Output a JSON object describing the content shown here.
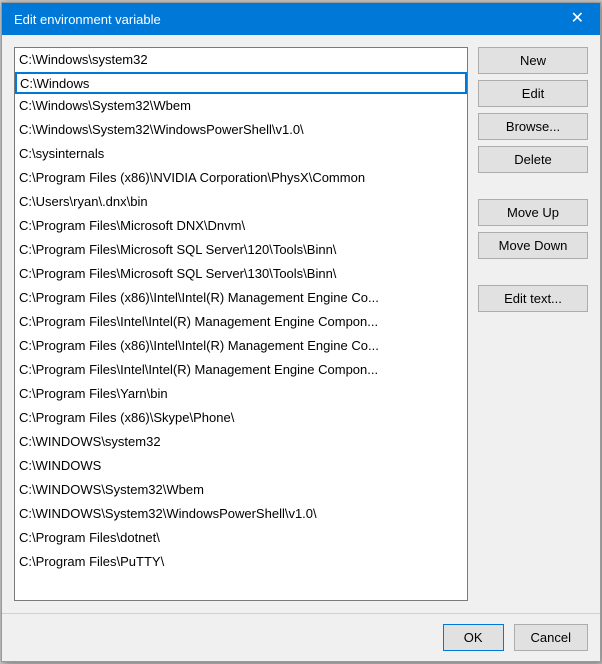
{
  "dialog": {
    "title": "Edit environment variable",
    "close_label": "✕"
  },
  "buttons": {
    "new_label": "New",
    "edit_label": "Edit",
    "browse_label": "Browse...",
    "delete_label": "Delete",
    "move_up_label": "Move Up",
    "move_down_label": "Move Down",
    "edit_text_label": "Edit text..."
  },
  "footer": {
    "ok_label": "OK",
    "cancel_label": "Cancel"
  },
  "list": {
    "top_item": "C:\\Windows\\system32",
    "editing_value": "C:\\Windows",
    "items": [
      "C:\\Windows\\System32\\Wbem",
      "C:\\Windows\\System32\\WindowsPowerShell\\v1.0\\",
      "C:\\sysinternals",
      "C:\\Program Files (x86)\\NVIDIA Corporation\\PhysX\\Common",
      "C:\\Users\\ryan\\.dnx\\bin",
      "C:\\Program Files\\Microsoft DNX\\Dnvm\\",
      "C:\\Program Files\\Microsoft SQL Server\\120\\Tools\\Binn\\",
      "C:\\Program Files\\Microsoft SQL Server\\130\\Tools\\Binn\\",
      "C:\\Program Files (x86)\\Intel\\Intel(R) Management Engine Co...",
      "C:\\Program Files\\Intel\\Intel(R) Management Engine Compon...",
      "C:\\Program Files (x86)\\Intel\\Intel(R) Management Engine Co...",
      "C:\\Program Files\\Intel\\Intel(R) Management Engine Compon...",
      "C:\\Program Files\\Yarn\\bin",
      "C:\\Program Files (x86)\\Skype\\Phone\\",
      "C:\\WINDOWS\\system32",
      "C:\\WINDOWS",
      "C:\\WINDOWS\\System32\\Wbem",
      "C:\\WINDOWS\\System32\\WindowsPowerShell\\v1.0\\",
      "C:\\Program Files\\dotnet\\",
      "C:\\Program Files\\PuTTY\\"
    ]
  }
}
